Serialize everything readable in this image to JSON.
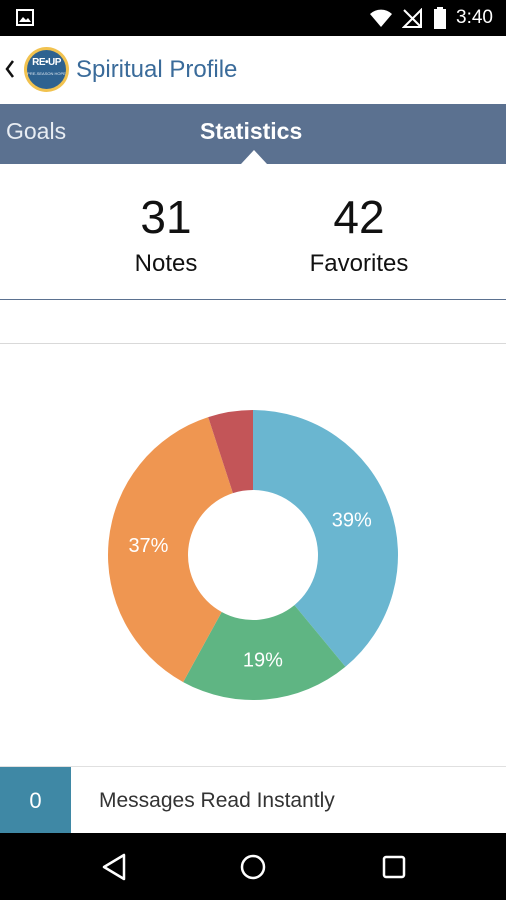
{
  "status_bar": {
    "time": "3:40",
    "icons": [
      "gallery-icon",
      "wifi-icon",
      "no-signal-icon",
      "battery-icon"
    ]
  },
  "app_bar": {
    "title": "Spiritual Profile",
    "logo_text": "RE•UP",
    "logo_subtext": "PRE-SEASON HOPE"
  },
  "tabs": [
    {
      "label": "Goals",
      "selected": false
    },
    {
      "label": "Statistics",
      "selected": true
    }
  ],
  "stats": {
    "notes": {
      "value": "31",
      "label": "Notes"
    },
    "favorites": {
      "value": "42",
      "label": "Favorites"
    }
  },
  "chart_data": {
    "type": "pie",
    "donut": true,
    "title": "",
    "slices": [
      {
        "label": "39%",
        "value": 39,
        "color": "#6ab6d0"
      },
      {
        "label": "19%",
        "value": 19,
        "color": "#5fb583"
      },
      {
        "label": "37%",
        "value": 37,
        "color": "#ef9651"
      },
      {
        "label": "",
        "value": 5,
        "color": "#c35558"
      }
    ]
  },
  "stat_rows": [
    {
      "count": "0",
      "label": "Messages Read Instantly"
    }
  ],
  "colors": {
    "tab_bar": "#5b7190",
    "title": "#3a6b9a",
    "stat_accent": "#3f88a5"
  }
}
